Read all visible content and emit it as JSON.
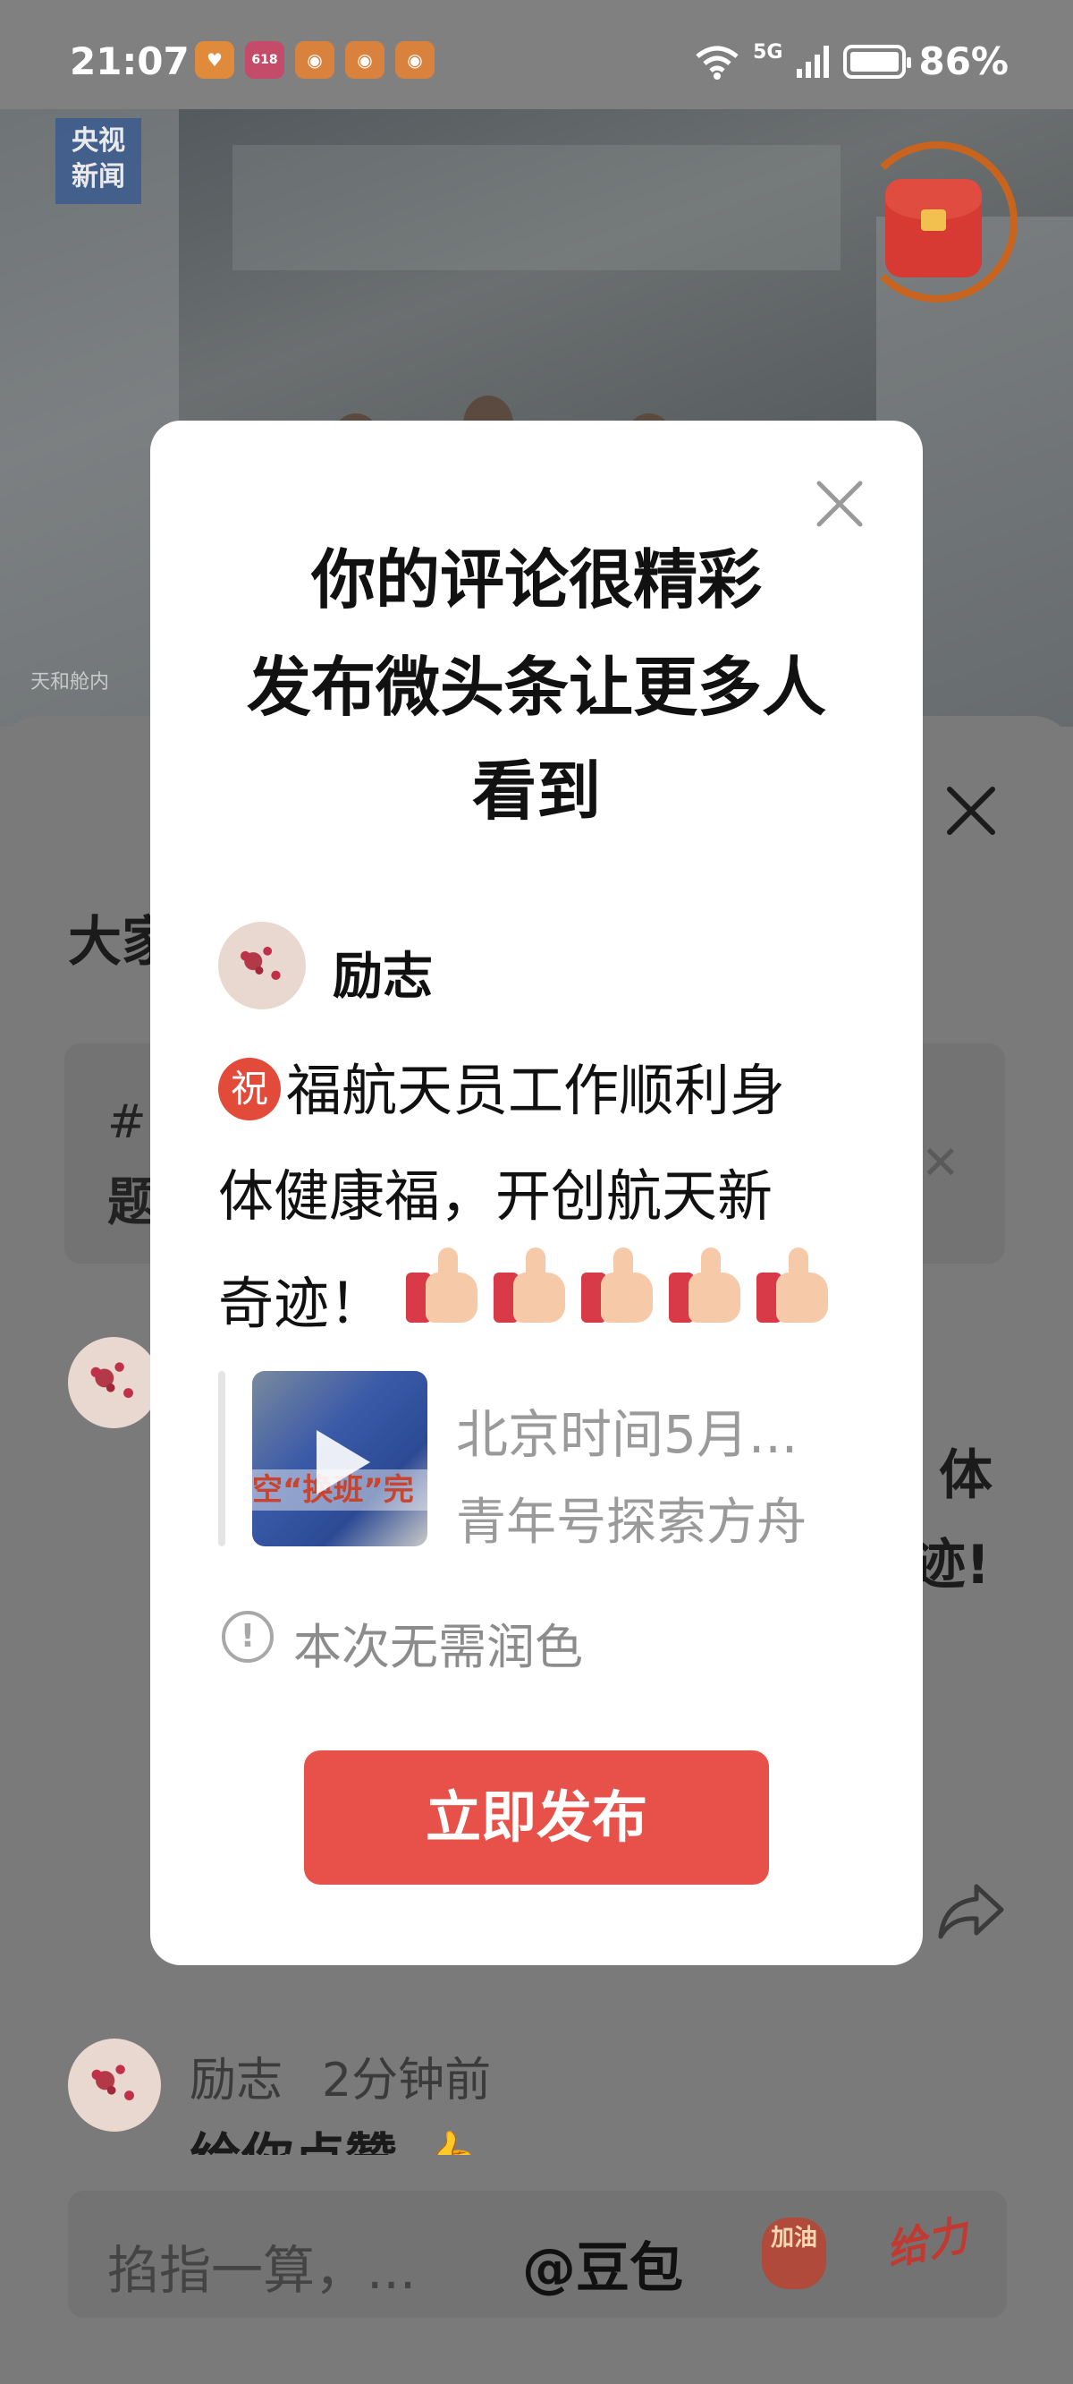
{
  "status_bar": {
    "time": "21:07",
    "network": "5G",
    "battery": "86%",
    "battery_level": 0.86,
    "app_icons": [
      "heart-app-icon",
      "618-app-icon",
      "app-icon",
      "app-icon",
      "app-icon"
    ]
  },
  "video": {
    "watermark": "央视\n新闻",
    "caption": "天和舱内",
    "icon": "red-packet-icon"
  },
  "sheet": {
    "title": "大家",
    "topic_icon": "#",
    "topic_text": "题",
    "behind_right_1": "体",
    "behind_right_2": "迹!",
    "reply": {
      "user": "励志",
      "time": "2分钟前",
      "text": "给你点赞 👍"
    }
  },
  "input_bar": {
    "placeholder": "掐指一算，...",
    "mention": "@豆包",
    "sticker_jiayou": "加油",
    "sticker_geili": "给力"
  },
  "modal": {
    "title_line1": "你的评论很精彩",
    "title_line2": "发布微头条让更多人",
    "title_line3": "看到",
    "username": "励志",
    "badge": "祝",
    "content_line1": "福航天员工作顺利身",
    "content_line2": "体健康福，开创航天新",
    "content_line3": "奇迹！",
    "thumbs_count": 5,
    "quote": {
      "title": "北京时间5月...",
      "source": "青年号探索方舟",
      "thumb_text": "空“换班”完"
    },
    "notice": "本次无需润色",
    "notice_icon": "!",
    "publish_label": "立即发布"
  }
}
